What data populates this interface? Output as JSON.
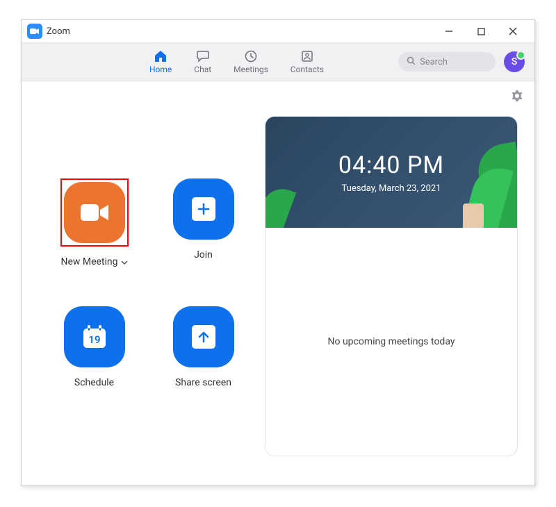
{
  "app": {
    "title": "Zoom"
  },
  "tabs": {
    "home": "Home",
    "chat": "Chat",
    "meetings": "Meetings",
    "contacts": "Contacts"
  },
  "search": {
    "placeholder": "Search"
  },
  "avatar": {
    "initial": "S"
  },
  "actions": {
    "new_meeting": "New Meeting",
    "join": "Join",
    "schedule": "Schedule",
    "schedule_day": "19",
    "share_screen": "Share screen"
  },
  "clock": {
    "time": "04:40 PM",
    "date": "Tuesday, March 23, 2021"
  },
  "upcoming": {
    "empty": "No upcoming meetings today"
  }
}
